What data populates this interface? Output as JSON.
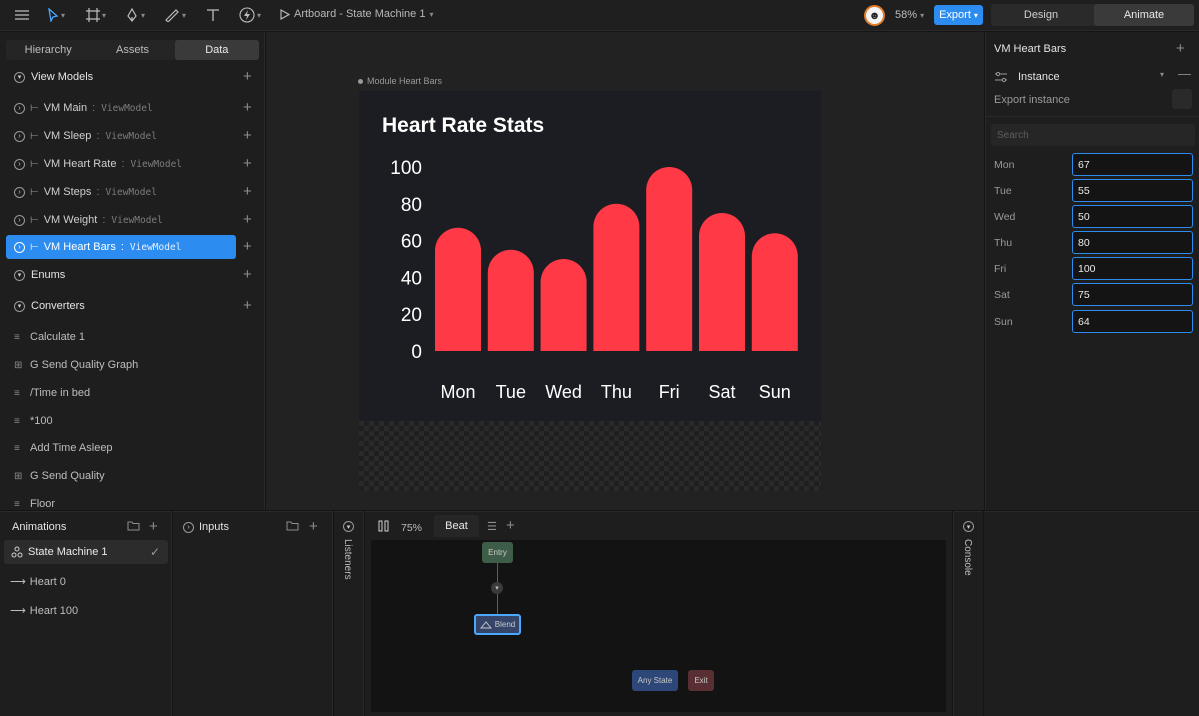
{
  "topbar": {
    "artboard_title": "Artboard - State Machine 1",
    "zoom": "58%",
    "export_label": "Export",
    "mode_design": "Design",
    "mode_animate": "Animate"
  },
  "left": {
    "tabs": [
      "Hierarchy",
      "Assets",
      "Data"
    ],
    "view_models_label": "View Models",
    "view_models": [
      {
        "name": "VM Main",
        "type": "ViewModel"
      },
      {
        "name": "VM Sleep",
        "type": "ViewModel"
      },
      {
        "name": "VM Heart Rate",
        "type": "ViewModel"
      },
      {
        "name": "VM Steps",
        "type": "ViewModel"
      },
      {
        "name": "VM Weight",
        "type": "ViewModel"
      },
      {
        "name": "VM Heart Bars",
        "type": "ViewModel"
      }
    ],
    "enums_label": "Enums",
    "converters_label": "Converters",
    "converters": [
      "Calculate 1",
      "G Send Quality Graph",
      "/Time in bed",
      "*100",
      "Add Time Asleep",
      "G Send Quality",
      "Floor"
    ]
  },
  "canvas": {
    "module_label": "Module  Heart Bars",
    "chart_data": {
      "type": "bar",
      "title": "Heart Rate Stats",
      "categories": [
        "Mon",
        "Tue",
        "Wed",
        "Thu",
        "Fri",
        "Sat",
        "Sun"
      ],
      "values": [
        67,
        55,
        50,
        80,
        100,
        75,
        64
      ],
      "yticks": [
        "100",
        "80",
        "60",
        "40",
        "20",
        "0"
      ],
      "ylim": [
        0,
        100
      ],
      "bar_color": "#ff3a46"
    }
  },
  "right": {
    "title": "VM Heart Bars",
    "instance_label": "Instance",
    "export_instance_label": "Export instance",
    "search_placeholder": "Search",
    "props": [
      {
        "label": "Mon",
        "value": "67"
      },
      {
        "label": "Tue",
        "value": "55"
      },
      {
        "label": "Wed",
        "value": "50"
      },
      {
        "label": "Thu",
        "value": "80"
      },
      {
        "label": "Fri",
        "value": "100"
      },
      {
        "label": "Sat",
        "value": "75"
      },
      {
        "label": "Sun",
        "value": "64"
      }
    ]
  },
  "bottom": {
    "animations_label": "Animations",
    "state_machine": "State Machine 1",
    "animations": [
      "Heart 0",
      "Heart 100"
    ],
    "inputs_label": "Inputs",
    "listeners_label": "Listeners",
    "sm_zoom": "75%",
    "sm_tab": "Beat",
    "nodes": {
      "entry": "Entry",
      "blend": "Blend",
      "any": "Any State",
      "exit": "Exit"
    },
    "console_label": "Console"
  }
}
